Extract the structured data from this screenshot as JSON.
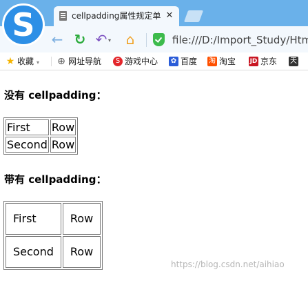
{
  "browser": {
    "tab": {
      "title": "cellpadding属性规定单",
      "close_glyph": "✕"
    },
    "nav": {
      "back_glyph": "←",
      "reload_glyph": "↻",
      "undo_glyph": "↶",
      "undo_caret": "▾",
      "home_glyph": "⌂",
      "url": "file:///D:/Import_Study/Html_"
    },
    "logo_glyph": "S",
    "colors": {
      "tabstrip": "#6ab1ea",
      "logo": "#2d8fe6",
      "reload": "#2bab3c",
      "shield": "#3dbb4c"
    }
  },
  "bookmarks": [
    {
      "label": "收藏",
      "icon": "star-icon",
      "glyph": "★"
    },
    {
      "label": "网址导航",
      "icon": "globe-icon",
      "glyph": "⊕"
    },
    {
      "label": "游戏中心",
      "icon": "game-icon",
      "glyph": "S"
    },
    {
      "label": "百度",
      "icon": "baidu-paw-icon",
      "glyph": "✿"
    },
    {
      "label": "淘宝",
      "icon": "taobao-icon",
      "glyph": "淘"
    },
    {
      "label": "京东",
      "icon": "jd-icon",
      "glyph": "JD"
    },
    {
      "label": "天",
      "icon": "tian-icon",
      "glyph": "天"
    }
  ],
  "bookmarks_caret": "▾",
  "page": {
    "heading_without": "没有 cellpadding：",
    "heading_with": "带有 cellpadding：",
    "table_without": [
      [
        "First",
        "Row"
      ],
      [
        "Second",
        "Row"
      ]
    ],
    "table_with": [
      [
        "First",
        "Row"
      ],
      [
        "Second",
        "Row"
      ]
    ],
    "watermark": "https://blog.csdn.net/aihiao"
  }
}
